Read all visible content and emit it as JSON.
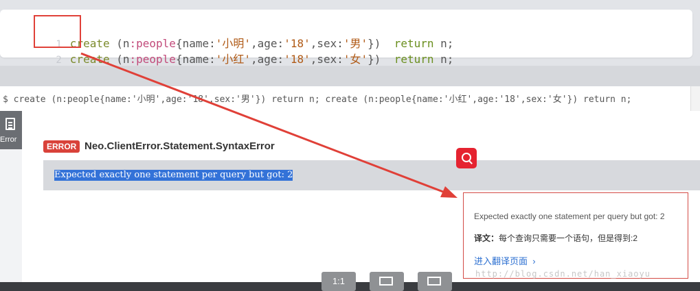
{
  "editor": {
    "lines": [
      {
        "num": "1",
        "kw": "create",
        "p1": " (",
        "var": "n",
        "colon": ":",
        "label": "people",
        "body1": "{name:",
        "name": "'小明'",
        "body2": ",age:",
        "age": "'18'",
        "body3": ",sex:",
        "sex": "'男'",
        "close": "})",
        "ret": "return",
        "tail": " n;"
      },
      {
        "num": "2",
        "kw": "create",
        "p1": " (",
        "var": "n",
        "colon": ":",
        "label": "people",
        "body1": "{name:",
        "name": "'小红'",
        "body2": ",age:",
        "age": "'18'",
        "body3": ",sex:",
        "sex": "'女'",
        "close": "})",
        "ret": "return",
        "tail": " n;"
      }
    ]
  },
  "command_bar": {
    "text": "$ create (n:people{name:'小明',age:'18',sex:'男'}) return n; create (n:people{name:'小红',age:'18',sex:'女'}) return n;"
  },
  "sidebar": {
    "tab_label": "Error",
    "tab_icon": "document-icon"
  },
  "error": {
    "badge": "ERROR",
    "title": "Neo.ClientError.Statement.SyntaxError",
    "message": "Expected exactly one statement per query but got: 2"
  },
  "translation_popup": {
    "source": "Expected exactly one statement per query but got: 2",
    "label": "译文：",
    "translation": "每个查询只需要一个语句，但是得到:2",
    "link": "进入翻译页面",
    "link_icon": "chevron-right-icon",
    "trigger_icon": "search-icon"
  },
  "viewer_toolbar": {
    "ratio_label": "1:1",
    "fit_icon": "fit-screen-icon",
    "crop_icon": "screenshot-edit-icon"
  },
  "watermark": "http://blog.csdn.net/han_xiaoyu",
  "colors": {
    "annotation_red": "#e04038",
    "error_badge": "#d9423a",
    "selection_blue": "#3372d8",
    "link_blue": "#2b6fd1"
  }
}
